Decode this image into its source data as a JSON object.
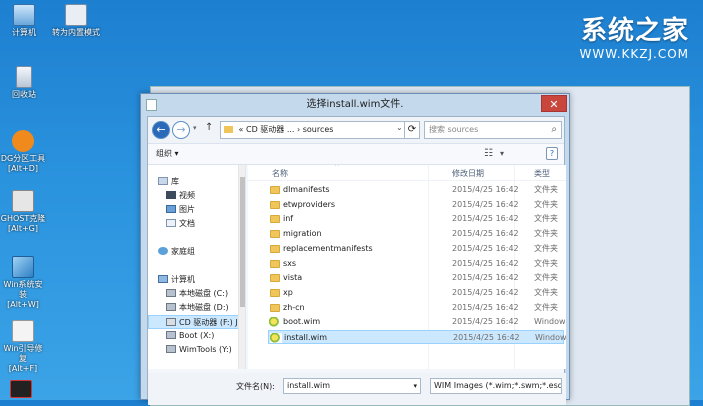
{
  "desktop": {
    "icons": [
      "计算机",
      "转为内置模式",
      "回收站",
      "DG分区工具",
      "[Alt+D]",
      "GHOST克隆",
      "[Alt+G]",
      "Win系统安装",
      "[Alt+W]",
      "Win引导修复",
      "[Alt+F]"
    ]
  },
  "brand": {
    "title": "系统之家",
    "url": "WWW.KKZJ.COM"
  },
  "dialog": {
    "title": "选择install.wim文件.",
    "close": "✕",
    "address": {
      "back": "←",
      "forward": "→",
      "up": "↑",
      "path": "« CD 驱动器 ... › sources",
      "dropdown": "⌄",
      "refresh": "⟳"
    },
    "search": {
      "placeholder": "搜索 sources",
      "icon": "⌕"
    },
    "toolbar": {
      "organize": "组织 ▾",
      "view_icon": "☷",
      "view_dd": "▾",
      "help": "?"
    },
    "nav": [
      {
        "label": "库",
        "icon": "library-icon"
      },
      {
        "label": "视频",
        "icon": "video-icon"
      },
      {
        "label": "图片",
        "icon": "picture-icon"
      },
      {
        "label": "文档",
        "icon": "document-icon"
      },
      {
        "label": "家庭组",
        "icon": "homegroup-icon"
      },
      {
        "label": "计算机",
        "icon": "computer-icon"
      },
      {
        "label": "本地磁盘 (C:)",
        "icon": "drive-icon"
      },
      {
        "label": "本地磁盘 (D:)",
        "icon": "drive-icon"
      },
      {
        "label": "CD 驱动器 (F:) J",
        "icon": "cd-icon"
      },
      {
        "label": "Boot (X:)",
        "icon": "drive-icon"
      },
      {
        "label": "WimTools (Y:)",
        "icon": "drive-icon"
      }
    ],
    "columns": {
      "name": "名称",
      "date": "修改日期",
      "type": "类型"
    },
    "files": [
      {
        "name": "dlmanifests",
        "date": "2015/4/25 16:42",
        "type": "文件夹"
      },
      {
        "name": "etwproviders",
        "date": "2015/4/25 16:42",
        "type": "文件夹"
      },
      {
        "name": "inf",
        "date": "2015/4/25 16:42",
        "type": "文件夹"
      },
      {
        "name": "migration",
        "date": "2015/4/25 16:42",
        "type": "文件夹"
      },
      {
        "name": "replacementmanifests",
        "date": "2015/4/25 16:42",
        "type": "文件夹"
      },
      {
        "name": "sxs",
        "date": "2015/4/25 16:42",
        "type": "文件夹"
      },
      {
        "name": "vista",
        "date": "2015/4/25 16:42",
        "type": "文件夹"
      },
      {
        "name": "xp",
        "date": "2015/4/25 16:42",
        "type": "文件夹"
      },
      {
        "name": "zh-cn",
        "date": "2015/4/25 16:42",
        "type": "文件夹"
      },
      {
        "name": "boot.wim",
        "date": "2015/4/25 16:42",
        "type": "Windows"
      },
      {
        "name": "install.wim",
        "date": "2015/4/25 16:42",
        "type": "Windows"
      }
    ],
    "filename_label": "文件名(N):",
    "filename_value": "install.wim",
    "filetype_value": "WIM Images (*.wim;*.swm;*.esd)"
  }
}
